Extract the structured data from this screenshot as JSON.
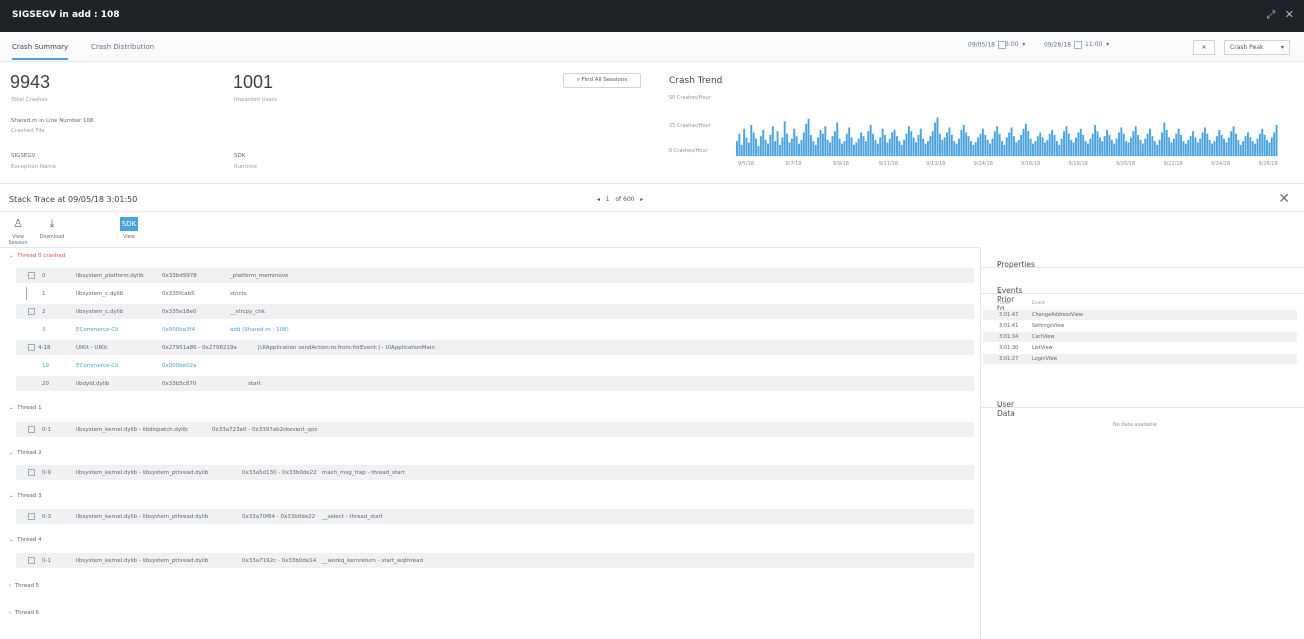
{
  "window": {
    "title": "SIGSEGV in add : 108",
    "actions": [
      "⤢",
      "✕"
    ]
  },
  "tabs": [
    {
      "label": "Crash Summary"
    },
    {
      "label": "Crash Distribution"
    }
  ],
  "filters": {
    "start_date": "09/05/18",
    "start_time": "3:00",
    "end_date": "09/26/18",
    "end_time": "11:00",
    "view_select": "Crash Peak"
  },
  "summary": {
    "total_crashes": "9943",
    "total_crashes_label": "Total Crashes",
    "impacted_users": "1001",
    "impacted_users_label": "Impacted Users",
    "crashed_file": "Shared.m in Line Number 108",
    "crashed_file_label": "Crashed File",
    "exception_name": "SIGSEGV",
    "exception_name_label": "Exception Name",
    "runtime": "SDK",
    "runtime_label": "Runtime",
    "find_sessions_label": "Find All Sessions"
  },
  "chart_data": {
    "type": "bar",
    "title": "Crash Trend",
    "ylabel_ticks": [
      "50 Crashes/Hour",
      "25 Crashes/Hour",
      "0 Crashes/Hour"
    ],
    "xticks": [
      "9/5/18",
      "9/7/18",
      "9/9/18",
      "9/11/18",
      "9/13/18",
      "9/14/18",
      "9/16/18",
      "9/18/18",
      "9/20/18",
      "9/22/18",
      "9/24/18",
      "9/26/18"
    ],
    "ylim": [
      0,
      50
    ],
    "values": [
      12,
      18,
      9,
      22,
      15,
      11,
      25,
      19,
      14,
      8,
      16,
      21,
      13,
      10,
      17,
      24,
      12,
      20,
      9,
      15,
      28,
      18,
      11,
      14,
      22,
      16,
      10,
      13,
      19,
      26,
      30,
      17,
      12,
      9,
      15,
      21,
      18,
      24,
      13,
      11,
      16,
      20,
      27,
      14,
      10,
      12,
      18,
      23,
      15,
      9,
      11,
      14,
      19,
      16,
      12,
      20,
      25,
      18,
      13,
      10,
      15,
      22,
      17,
      11,
      14,
      19,
      21,
      16,
      12,
      9,
      13,
      18,
      24,
      20,
      15,
      11,
      17,
      22,
      14,
      10,
      12,
      16,
      20,
      27,
      31,
      18,
      13,
      15,
      19,
      23,
      17,
      12,
      10,
      14,
      21,
      25,
      19,
      16,
      12,
      9,
      11,
      15,
      18,
      22,
      17,
      13,
      10,
      14,
      20,
      24,
      18,
      12,
      9,
      15,
      19,
      23,
      16,
      11,
      13,
      17,
      22,
      26,
      20,
      14,
      10,
      12,
      16,
      19,
      15,
      11,
      13,
      18,
      21,
      17,
      12,
      9,
      14,
      20,
      24,
      18,
      13,
      11,
      15,
      19,
      22,
      17,
      12,
      10,
      14,
      18,
      25,
      20,
      15,
      12,
      16,
      21,
      17,
      13,
      10,
      14,
      19,
      23,
      18,
      12,
      11,
      15,
      20,
      24,
      17,
      13,
      10,
      14,
      18,
      22,
      16,
      12,
      9,
      13,
      19,
      27,
      21,
      15,
      11,
      14,
      18,
      22,
      17,
      12,
      10,
      13,
      16,
      20,
      15,
      11,
      14,
      19,
      23,
      18,
      13,
      10,
      12,
      16,
      21,
      17,
      14,
      11,
      15,
      20,
      24,
      18,
      13,
      9,
      12,
      16,
      19,
      15,
      12,
      10,
      14,
      18,
      22,
      17,
      13,
      11,
      15,
      19,
      25
    ]
  },
  "stack": {
    "title": "Stack Trace at 09/05/18 3:01:50",
    "page": "1",
    "of_pages": "of 600",
    "tools": [
      {
        "label": "View Session",
        "icon": "person"
      },
      {
        "label": "Download",
        "icon": "download"
      },
      {
        "label": "View",
        "icon": "view",
        "badge": "SDK"
      }
    ]
  },
  "threads": [
    {
      "label": "Thread 0 crashed",
      "rows": [
        {
          "idx": "0",
          "lib": "libsystem_platform.dylib",
          "addr": "0x33bd9978",
          "fn": "_platform_memmove",
          "expand": true
        },
        {
          "idx": "1",
          "lib": "libsystem_c.dylib",
          "addr": "0x335fcab5",
          "fn": "stncts",
          "expand": false
        },
        {
          "idx": "2",
          "lib": "libsystem_c.dylib",
          "addr": "0x335e18e0",
          "fn": "__strcpy_chk",
          "expand": true
        },
        {
          "idx": "3",
          "lib": "ECommerce-Cli",
          "addr": "0x000be3f4",
          "fn": "add (Shared.m : 108)",
          "expand": false,
          "link": true
        },
        {
          "idx": "4-18",
          "lib": "UIKit - UIKit",
          "addr": "0x27951a86 - 0x2798219a",
          "fn": "[UIApplication sendAction:to:from:forEvent:] - UIApplicationMain",
          "expand": true
        },
        {
          "idx": "19",
          "lib": "ECommerce-Cli",
          "addr": "0x000be02a",
          "fn": "",
          "expand": false,
          "link": true
        },
        {
          "idx": "20",
          "lib": "libdyld.dylib",
          "addr": "0x33b5c870",
          "fn": "start",
          "expand": false
        }
      ]
    },
    {
      "label": "Thread 1",
      "rows": [
        {
          "idx": "0-1",
          "lib": "libsystem_kernel.dylib - libdispatch.dylib",
          "addr": "0x33a723e0 - 0x3397ab2c",
          "fn": "kevent_qos",
          "expand": true
        }
      ]
    },
    {
      "label": "Thread 2",
      "rows": [
        {
          "idx": "0-9",
          "lib": "libsystem_kernel.dylib - libsystem_pthread.dylib",
          "addr": "0x33a5d130 - 0x33b0de22",
          "fn": "mach_msg_trap - thread_start",
          "expand": true
        }
      ]
    },
    {
      "label": "Thread 3",
      "rows": [
        {
          "idx": "0-3",
          "lib": "libsystem_kernel.dylib - libsystem_pthread.dylib",
          "addr": "0x33a70f64 - 0x33b0de22",
          "fn": "__select - thread_start",
          "expand": true
        }
      ]
    },
    {
      "label": "Thread 4",
      "rows": [
        {
          "idx": "0-1",
          "lib": "libsystem_kernel.dylib - libsystem_pthread.dylib",
          "addr": "0x33a7192c - 0x33b0de14",
          "fn": "__workq_kernreturn - start_wqthread",
          "expand": true
        }
      ]
    },
    {
      "label": "Thread 5",
      "rows": [],
      "collapsed": true
    },
    {
      "label": "Thread 6",
      "rows": [],
      "collapsed": true
    }
  ],
  "right": {
    "properties_label": "Properties",
    "events_label": "Events Prior to Crash",
    "events_head_time": "Time",
    "events_head_event": "Event",
    "events": [
      {
        "time": "3:01:47",
        "event": "ChangeAddressView"
      },
      {
        "time": "3:01:41",
        "event": "SettingsView"
      },
      {
        "time": "3:01:34",
        "event": "CartView"
      },
      {
        "time": "3:01:30",
        "event": "ListView"
      },
      {
        "time": "3:01:27",
        "event": "LoginView"
      }
    ],
    "user_data_label": "User Data",
    "no_data": "No data available"
  },
  "colors": {
    "accent": "#4aa3df",
    "crashed": "#d9534f",
    "titlebar": "#1f2227",
    "bar": "#4aa3df"
  }
}
